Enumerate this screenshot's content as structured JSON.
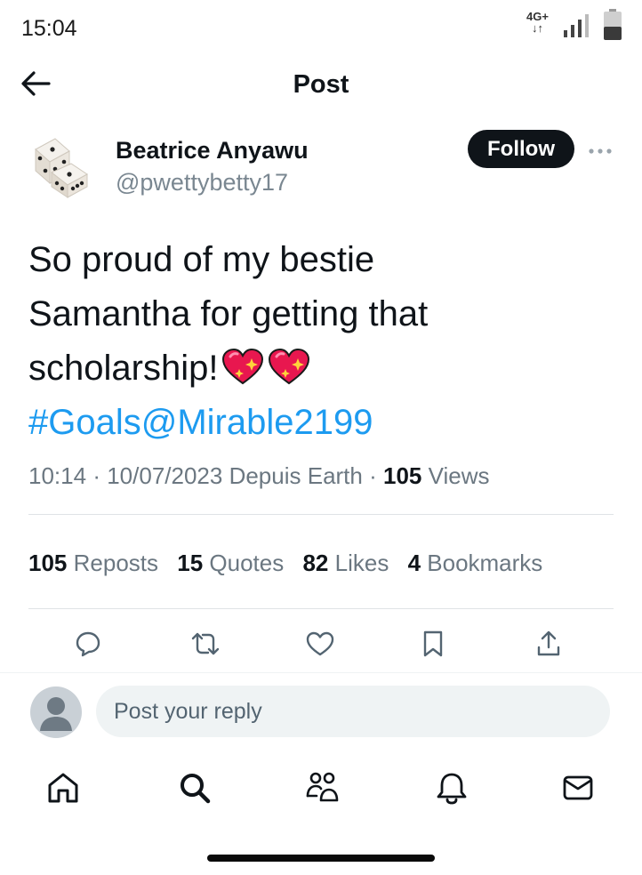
{
  "status_bar": {
    "time": "15:04",
    "network_type": "4G+",
    "network_arrows": "↓↑"
  },
  "header": {
    "title": "Post",
    "back_icon": "arrow-left-icon"
  },
  "post": {
    "author": {
      "name": "Beatrice Anyawu",
      "handle": "@pwettybetty17",
      "avatar_icon": "dice-icon"
    },
    "follow_label": "Follow",
    "text_line_1": "So proud of my bestie",
    "text_line_2": "Samantha for getting that",
    "text_line_3": "scholarship!",
    "emoji": "💖 💖",
    "link_text": "#Goals@Mirable2199",
    "time": "10:14",
    "separator": "·",
    "date_location": "10/07/2023 Depuis Earth",
    "views_count": "105",
    "views_label": "Views"
  },
  "stats": [
    {
      "count": "105",
      "label": "Reposts"
    },
    {
      "count": "15",
      "label": "Quotes"
    },
    {
      "count": "82",
      "label": "Likes"
    },
    {
      "count": "4",
      "label": "Bookmarks"
    }
  ],
  "actions": [
    "reply-icon",
    "repost-icon",
    "like-icon",
    "bookmark-icon",
    "share-icon"
  ],
  "reply": {
    "placeholder": "Post your reply"
  },
  "bottom_nav": [
    "home-icon",
    "search-icon",
    "communities-icon",
    "notifications-icon",
    "messages-icon"
  ],
  "colors": {
    "link": "#1d9bf0",
    "text": "#0f1419",
    "muted": "#6b7781",
    "follow_bg": "#0f1419"
  }
}
